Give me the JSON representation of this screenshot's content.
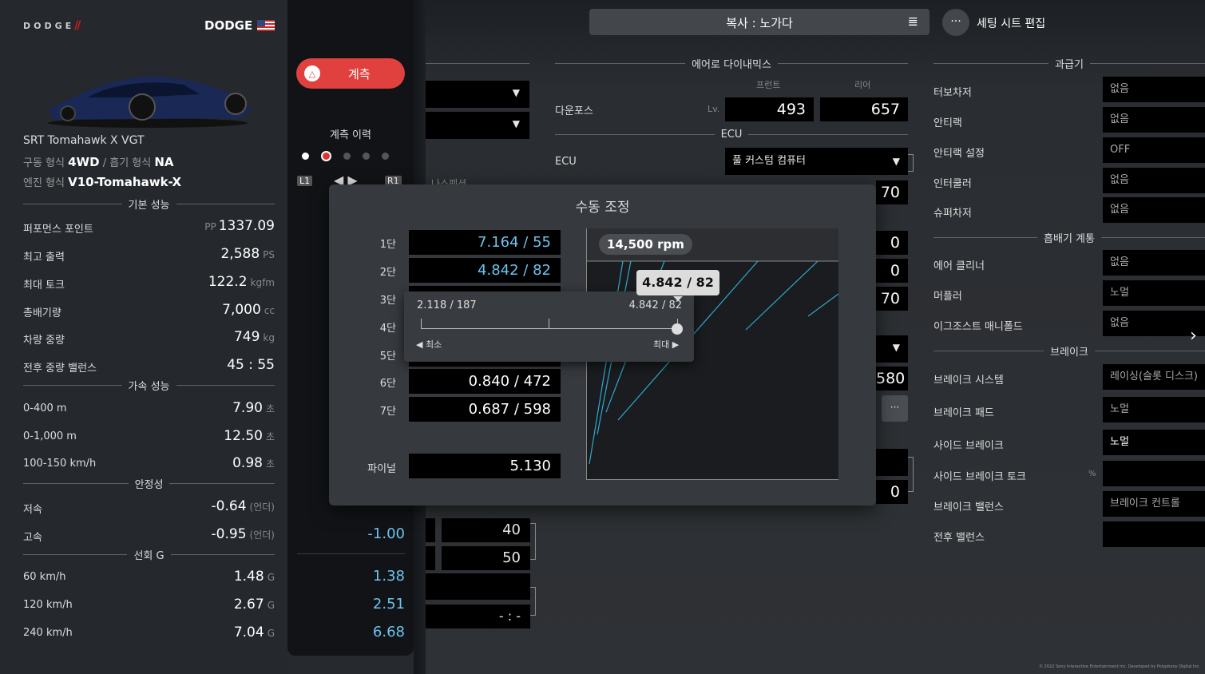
{
  "car": {
    "brand_logo": "DODGE",
    "maker": "DODGE",
    "flag": "us-flag-icon",
    "name": "SRT Tomahawk X VGT",
    "drive_label": "구동 형식",
    "drive": "4WD",
    "intake_label": "흡기 형식",
    "intake": "NA",
    "engine_label": "엔진 형식",
    "engine": "V10-Tomahawk-X",
    "sep": "/"
  },
  "basic": {
    "title": "기본 성능",
    "rows": [
      {
        "label": "퍼포먼스 포인트",
        "prefix": "PP",
        "value": "1337.09",
        "unit": ""
      },
      {
        "label": "최고 출력",
        "prefix": "",
        "value": "2,588",
        "unit": "PS"
      },
      {
        "label": "최대 토크",
        "prefix": "",
        "value": "122.2",
        "unit": "kgfm"
      },
      {
        "label": "총배기량",
        "prefix": "",
        "value": "7,000",
        "unit": "cc"
      },
      {
        "label": "차량 중량",
        "prefix": "",
        "value": "749",
        "unit": "kg"
      },
      {
        "label": "전후 중량 밸런스",
        "prefix": "",
        "value": "45 : 55",
        "unit": ""
      }
    ]
  },
  "accel": {
    "title": "가속 성능",
    "rows": [
      {
        "label": "0-400 m",
        "value": "7.90",
        "unit": "초",
        "new": ""
      },
      {
        "label": "0-1,000 m",
        "value": "12.50",
        "unit": "초",
        "new": ""
      },
      {
        "label": "100-150 km/h",
        "value": "0.98",
        "unit": "초",
        "new": ""
      }
    ]
  },
  "stability": {
    "title": "안정성",
    "rows": [
      {
        "label": "저속",
        "value": "-0.64",
        "unit": "(언더)",
        "new": ""
      },
      {
        "label": "고속",
        "value": "-0.95",
        "unit": "(언더)",
        "new": "-1.00"
      }
    ]
  },
  "cornering": {
    "title": "선회 G",
    "rows": [
      {
        "label": "60 km/h",
        "value": "1.48",
        "unit": "G",
        "new": "1.38"
      },
      {
        "label": "120 km/h",
        "value": "2.67",
        "unit": "G",
        "new": "2.51"
      },
      {
        "label": "240 km/h",
        "value": "7.04",
        "unit": "G",
        "new": "6.68"
      }
    ]
  },
  "measure": {
    "button": "계측",
    "history": "계측 이력",
    "l1": "L1",
    "r1": "R1"
  },
  "top": {
    "sheet_title": "복사 : 노가다",
    "edit_label": "세팅 시트 편집",
    "more": "···"
  },
  "aero": {
    "title": "에어로 다이내믹스",
    "front": "프런트",
    "rear": "리어",
    "downforce": "다운포스",
    "lv": "Lv.",
    "front_val": "493",
    "rear_val": "657"
  },
  "ecu": {
    "title": "ECU",
    "label": "ECU",
    "value": "풀 커스텀 컴퓨터",
    "partial": "70"
  },
  "mid_values": {
    "v1": "0",
    "v2": "0",
    "v3": "70",
    "v4": "580",
    "v5": "0",
    "v6": "40",
    "v7": "50",
    "v8": "- : -",
    "partial_text": "나스펜션"
  },
  "supercharger": {
    "title": "과급기",
    "rows": [
      {
        "label": "터보차저",
        "value": "없음"
      },
      {
        "label": "안티랙",
        "value": "없음"
      },
      {
        "label": "안티랙 설정",
        "value": "OFF"
      },
      {
        "label": "인터쿨러",
        "value": "없음"
      },
      {
        "label": "슈퍼차저",
        "value": "없음"
      }
    ]
  },
  "exhaust": {
    "title": "흡배기 계통",
    "rows": [
      {
        "label": "에어 클리너",
        "value": "없음"
      },
      {
        "label": "머플러",
        "value": "노멀"
      },
      {
        "label": "이그조스트 매니폴드",
        "value": "없음"
      }
    ]
  },
  "brake": {
    "title": "브레이크",
    "rows": [
      {
        "label": "브레이크 시스템",
        "value": "레이싱(슬롯 디스크)"
      },
      {
        "label": "브레이크 패드",
        "value": "노멀"
      },
      {
        "label": "사이드 브레이크",
        "value": "노멀"
      },
      {
        "label": "사이드 브레이크 토크",
        "value": "",
        "unit": "%"
      },
      {
        "label": "브레이크 밸런스",
        "value": "브레이크 컨트롤"
      },
      {
        "label": "전후 밸런스",
        "value": ""
      }
    ]
  },
  "modal": {
    "title": "수동 조정",
    "gears": [
      {
        "label": "1단",
        "value": "7.164 / 55"
      },
      {
        "label": "2단",
        "value": "4.842 / 82"
      },
      {
        "label": "3단",
        "value": ""
      },
      {
        "label": "4단",
        "value": ""
      },
      {
        "label": "5단",
        "value": ""
      },
      {
        "label": "6단",
        "value": "0.840 / 472"
      },
      {
        "label": "7단",
        "value": "0.687 / 598"
      }
    ],
    "final_label": "파이널",
    "final_value": "5.130",
    "rpm": "14,500 rpm",
    "tooltip": "4.842 / 82",
    "slider_min": "2.118 / 187",
    "slider_max": "4.842 / 82",
    "min_label": "최소",
    "max_label": "최대",
    "slider_level": 1.0
  },
  "copyright": "© 2022 Sony Interactive Entertainment Inc. Developed by Polyphony Digital Inc."
}
